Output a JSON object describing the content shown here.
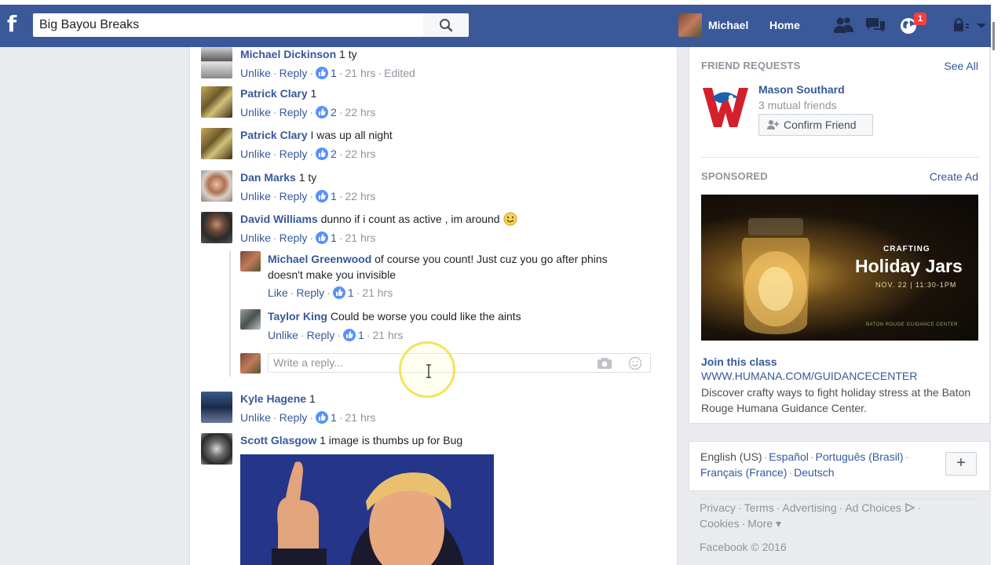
{
  "topbar": {
    "logo": "f",
    "search_value": "Big Bayou Breaks",
    "user_name": "Michael",
    "home_label": "Home",
    "notification_count": "1"
  },
  "comments": [
    {
      "name": "Michael Dickinson",
      "text": "1 ty",
      "actions": [
        "Unlike",
        "Reply"
      ],
      "likes": "1",
      "time": "21 hrs",
      "extra": "Edited"
    },
    {
      "name": "Patrick Clary",
      "text": "1",
      "actions": [
        "Unlike",
        "Reply"
      ],
      "likes": "2",
      "time": "22 hrs"
    },
    {
      "name": "Patrick Clary",
      "text": "I was up all night",
      "actions": [
        "Unlike",
        "Reply"
      ],
      "likes": "2",
      "time": "22 hrs"
    },
    {
      "name": "Dan Marks",
      "text": "1 ty",
      "actions": [
        "Unlike",
        "Reply"
      ],
      "likes": "1",
      "time": "22 hrs"
    },
    {
      "name": "David Williams",
      "text": "dunno if i count as active , im around",
      "actions": [
        "Unlike",
        "Reply"
      ],
      "likes": "1",
      "time": "21 hrs"
    }
  ],
  "replies": [
    {
      "name": "Michael Greenwood",
      "text_line1": "of course you count! Just cuz you go after phins",
      "text_line2": "doesn't make you invisible",
      "actions": [
        "Like",
        "Reply"
      ],
      "likes": "1",
      "time": "21 hrs"
    },
    {
      "name": "Taylor King",
      "text": "Could be worse you could like the aints",
      "actions": [
        "Unlike",
        "Reply"
      ],
      "likes": "1",
      "time": "21 hrs"
    }
  ],
  "write_reply_placeholder": "Write a reply...",
  "comments_after": [
    {
      "name": "Kyle Hagene",
      "text": "1",
      "actions": [
        "Unlike",
        "Reply"
      ],
      "likes": "1",
      "time": "21 hrs"
    },
    {
      "name": "Scott Glasgow",
      "text": "1 image is thumbs up for Bug"
    }
  ],
  "friend_requests": {
    "title": "FRIEND REQUESTS",
    "see_all": "See All",
    "name": "Mason Southard",
    "mutual": "3 mutual friends",
    "confirm_label": "Confirm Friend"
  },
  "sponsored": {
    "title": "SPONSORED",
    "create_ad": "Create Ad",
    "image_text_top": "CRAFTING",
    "image_text_main": "Holiday Jars",
    "image_text_date": "NOV. 22 | 11:30-1PM",
    "image_text_footer": "BATON ROUGE GUIDANCE CENTER",
    "ad_title": "Join this class",
    "ad_url": "WWW.HUMANA.COM/GUIDANCECENTER",
    "ad_desc": "Discover crafty ways to fight holiday stress at the Baton Rouge Humana Guidance Center."
  },
  "languages": {
    "current": "English (US)",
    "others_line1": [
      "Español",
      "Português (Brasil)"
    ],
    "others_line2": [
      "Français (France)",
      "Deutsch"
    ],
    "plus": "+"
  },
  "footer": {
    "line1": [
      "Privacy",
      "Terms",
      "Advertising",
      "Ad Choices"
    ],
    "line2": [
      "Cookies",
      "More ▾"
    ],
    "copyright": "Facebook © 2016"
  }
}
